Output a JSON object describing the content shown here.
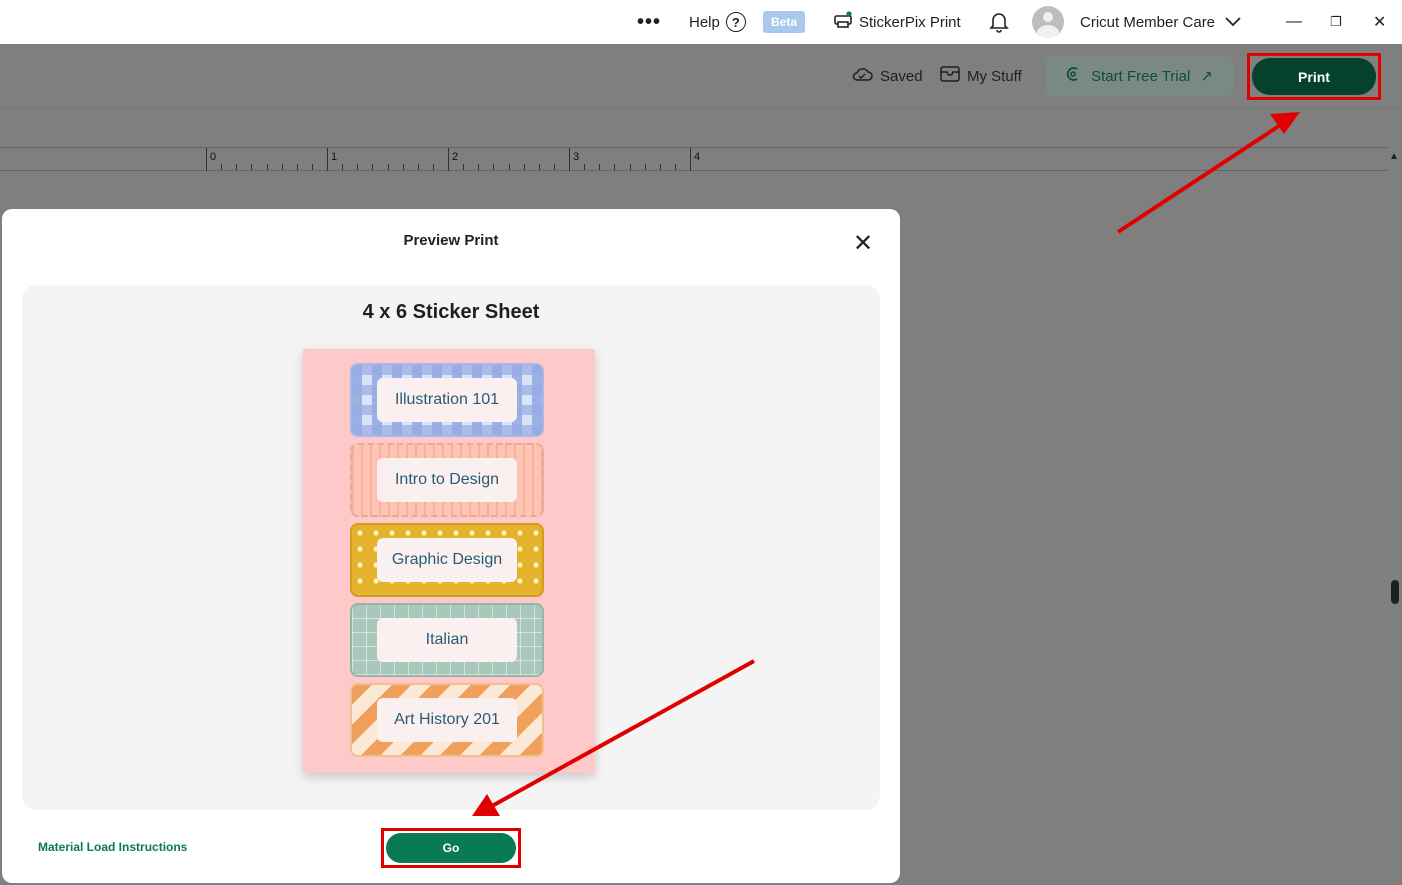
{
  "titlebar": {
    "more_icon": "more-horizontal-icon",
    "help_label": "Help",
    "help_icon": "?",
    "beta_label": "Beta",
    "stickerpix_label": "StickerPix Print",
    "member_label": "Cricut Member Care",
    "min_glyph": "—",
    "max_glyph": "❐",
    "close_glyph": "✕"
  },
  "toolbar": {
    "saved_label": "Saved",
    "mystuff_label": "My Stuff",
    "trial_label": "Start Free Trial",
    "trial_arrow": "↗",
    "print_label": "Print"
  },
  "ruler": {
    "labels": [
      "0",
      "1",
      "2",
      "3",
      "4"
    ]
  },
  "modal": {
    "title": "Preview Print",
    "close_glyph": "✕",
    "sheet_title": "4 x 6 Sticker Sheet",
    "stickers": [
      "Illustration 101",
      "Intro to Design",
      "Graphic Design",
      "Italian",
      "Art History 201"
    ],
    "material_link": "Material Load Instructions",
    "go_label": "Go"
  },
  "colors": {
    "accent_dark_green": "#06412f",
    "go_green": "#0a7a54",
    "annotation_red": "#e00000",
    "sheet_pink": "#ffc9c9"
  }
}
